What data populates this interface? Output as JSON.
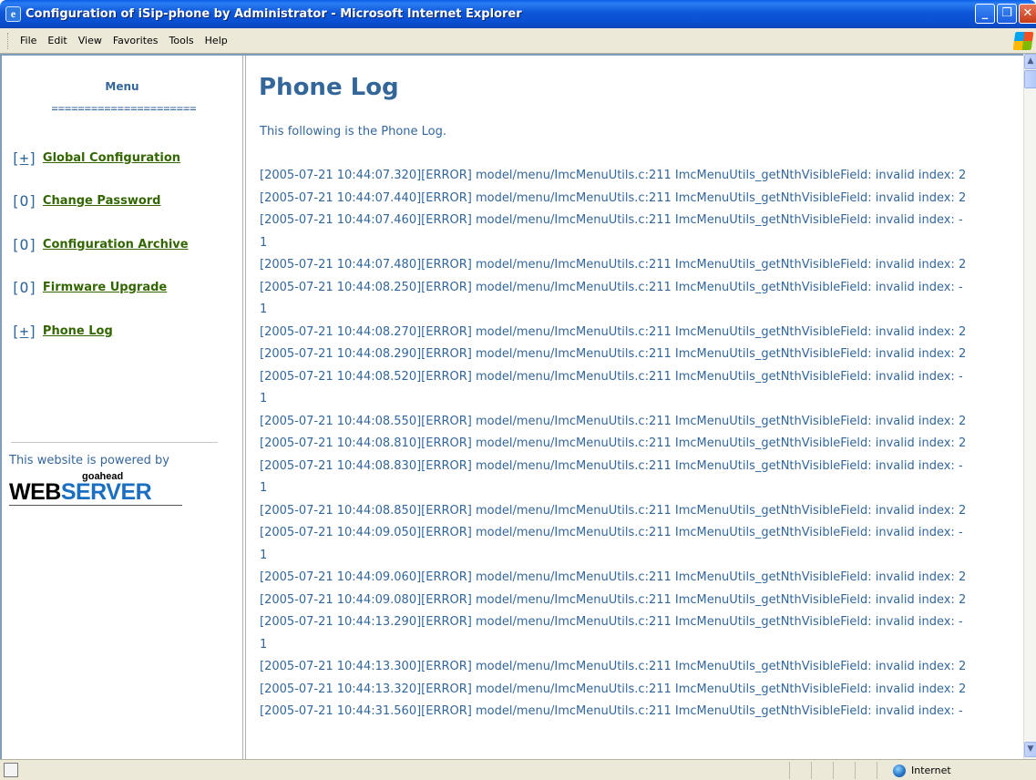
{
  "window": {
    "title": "Configuration of iSip-phone by Administrator - Microsoft Internet Explorer",
    "icon": "ie-page-icon",
    "buttons": [
      "minimize",
      "maximize",
      "close"
    ]
  },
  "menubar": {
    "items": [
      "File",
      "Edit",
      "View",
      "Favorites",
      "Tools",
      "Help"
    ]
  },
  "sidebar": {
    "title": "Menu",
    "separator": "======================",
    "items": [
      {
        "bracket_left": "[",
        "mark": "+",
        "bracket_right": "]",
        "label": "Global Configuration"
      },
      {
        "bracket_left": "[",
        "mark": "O",
        "bracket_right": "]",
        "label": "Change Password"
      },
      {
        "bracket_left": "[",
        "mark": "O",
        "bracket_right": "]",
        "label": "Configuration Archive"
      },
      {
        "bracket_left": "[",
        "mark": "O",
        "bracket_right": "]",
        "label": "Firmware Upgrade"
      },
      {
        "bracket_left": "[",
        "mark": "+",
        "bracket_right": "]",
        "label": "Phone Log"
      }
    ],
    "powered_by": "This website is powered by",
    "logo": {
      "small": "goahead",
      "web": "WEB",
      "server": "SERVER"
    }
  },
  "main": {
    "title": "Phone Log",
    "intro": "This following is the Phone Log.",
    "log_lines": [
      "[2005-07-21 10:44:07.320][ERROR] model/menu/ImcMenuUtils.c:211 ImcMenuUtils_getNthVisibleField: invalid index: 2",
      "[2005-07-21 10:44:07.440][ERROR] model/menu/ImcMenuUtils.c:211 ImcMenuUtils_getNthVisibleField: invalid index: 2",
      "[2005-07-21 10:44:07.460][ERROR] model/menu/ImcMenuUtils.c:211 ImcMenuUtils_getNthVisibleField: invalid index: -",
      "1",
      "[2005-07-21 10:44:07.480][ERROR] model/menu/ImcMenuUtils.c:211 ImcMenuUtils_getNthVisibleField: invalid index: 2",
      "[2005-07-21 10:44:08.250][ERROR] model/menu/ImcMenuUtils.c:211 ImcMenuUtils_getNthVisibleField: invalid index: -",
      "1",
      "[2005-07-21 10:44:08.270][ERROR] model/menu/ImcMenuUtils.c:211 ImcMenuUtils_getNthVisibleField: invalid index: 2",
      "[2005-07-21 10:44:08.290][ERROR] model/menu/ImcMenuUtils.c:211 ImcMenuUtils_getNthVisibleField: invalid index: 2",
      "[2005-07-21 10:44:08.520][ERROR] model/menu/ImcMenuUtils.c:211 ImcMenuUtils_getNthVisibleField: invalid index: -",
      "1",
      "[2005-07-21 10:44:08.550][ERROR] model/menu/ImcMenuUtils.c:211 ImcMenuUtils_getNthVisibleField: invalid index: 2",
      "[2005-07-21 10:44:08.810][ERROR] model/menu/ImcMenuUtils.c:211 ImcMenuUtils_getNthVisibleField: invalid index: 2",
      "[2005-07-21 10:44:08.830][ERROR] model/menu/ImcMenuUtils.c:211 ImcMenuUtils_getNthVisibleField: invalid index: -",
      "1",
      "[2005-07-21 10:44:08.850][ERROR] model/menu/ImcMenuUtils.c:211 ImcMenuUtils_getNthVisibleField: invalid index: 2",
      "[2005-07-21 10:44:09.050][ERROR] model/menu/ImcMenuUtils.c:211 ImcMenuUtils_getNthVisibleField: invalid index: -",
      "1",
      "[2005-07-21 10:44:09.060][ERROR] model/menu/ImcMenuUtils.c:211 ImcMenuUtils_getNthVisibleField: invalid index: 2",
      "[2005-07-21 10:44:09.080][ERROR] model/menu/ImcMenuUtils.c:211 ImcMenuUtils_getNthVisibleField: invalid index: 2",
      "[2005-07-21 10:44:13.290][ERROR] model/menu/ImcMenuUtils.c:211 ImcMenuUtils_getNthVisibleField: invalid index: -",
      "1",
      "[2005-07-21 10:44:13.300][ERROR] model/menu/ImcMenuUtils.c:211 ImcMenuUtils_getNthVisibleField: invalid index: 2",
      "[2005-07-21 10:44:13.320][ERROR] model/menu/ImcMenuUtils.c:211 ImcMenuUtils_getNthVisibleField: invalid index: 2",
      "[2005-07-21 10:44:31.560][ERROR] model/menu/ImcMenuUtils.c:211 ImcMenuUtils_getNthVisibleField: invalid index: -"
    ]
  },
  "statusbar": {
    "zone": "Internet"
  },
  "colors": {
    "heading": "#336699",
    "link": "#336600",
    "titlebar": "#0a4fd0"
  }
}
